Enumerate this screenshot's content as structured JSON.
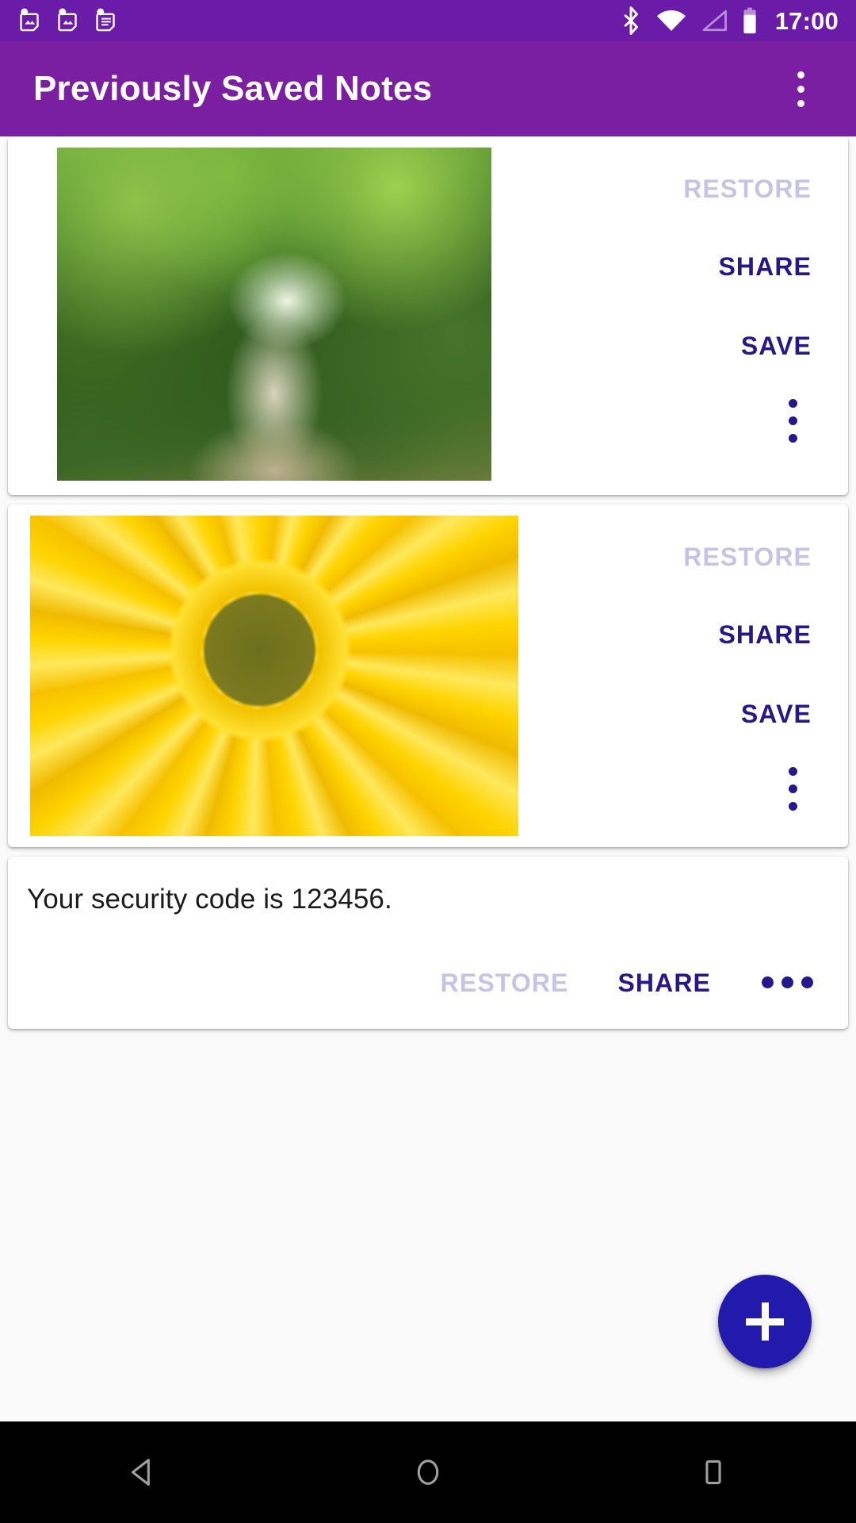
{
  "status_bar": {
    "time": "17:00",
    "notification_icons": [
      "note-image-icon",
      "note-image-icon",
      "note-text-icon"
    ],
    "system_icons": [
      "bluetooth-icon",
      "wifi-icon",
      "cellular-signal-icon",
      "battery-icon"
    ],
    "background_color": "#6a1ba8"
  },
  "app_bar": {
    "title": "Previously Saved Notes",
    "overflow_label": "more-options",
    "background_color": "#7b1fa2",
    "text_color": "#ffffff"
  },
  "colors": {
    "action_enabled": "#26188c",
    "action_disabled": "#c6c3e6",
    "fab": "#2219ad",
    "card": "#ffffff",
    "page_background": "#fafafa"
  },
  "notes": [
    {
      "type": "image",
      "image_alt": "green-forest-path-photo",
      "actions": [
        {
          "label": "RESTORE",
          "enabled": false
        },
        {
          "label": "SHARE",
          "enabled": true
        },
        {
          "label": "SAVE",
          "enabled": true
        }
      ],
      "overflow": "more-options"
    },
    {
      "type": "image",
      "image_alt": "yellow-sunflower-photo",
      "actions": [
        {
          "label": "RESTORE",
          "enabled": false
        },
        {
          "label": "SHARE",
          "enabled": true
        },
        {
          "label": "SAVE",
          "enabled": true
        }
      ],
      "overflow": "more-options"
    },
    {
      "type": "text",
      "body": "Your security code is 123456.",
      "actions": [
        {
          "label": "RESTORE",
          "enabled": false
        },
        {
          "label": "SHARE",
          "enabled": true
        }
      ],
      "overflow": "more-options"
    }
  ],
  "fab": {
    "label": "add-note",
    "icon": "plus-icon"
  },
  "nav_bar": {
    "buttons": [
      {
        "label": "back",
        "icon": "triangle-back-icon"
      },
      {
        "label": "home",
        "icon": "circle-home-icon"
      },
      {
        "label": "recents",
        "icon": "square-recents-icon"
      }
    ],
    "background_color": "#000000"
  }
}
